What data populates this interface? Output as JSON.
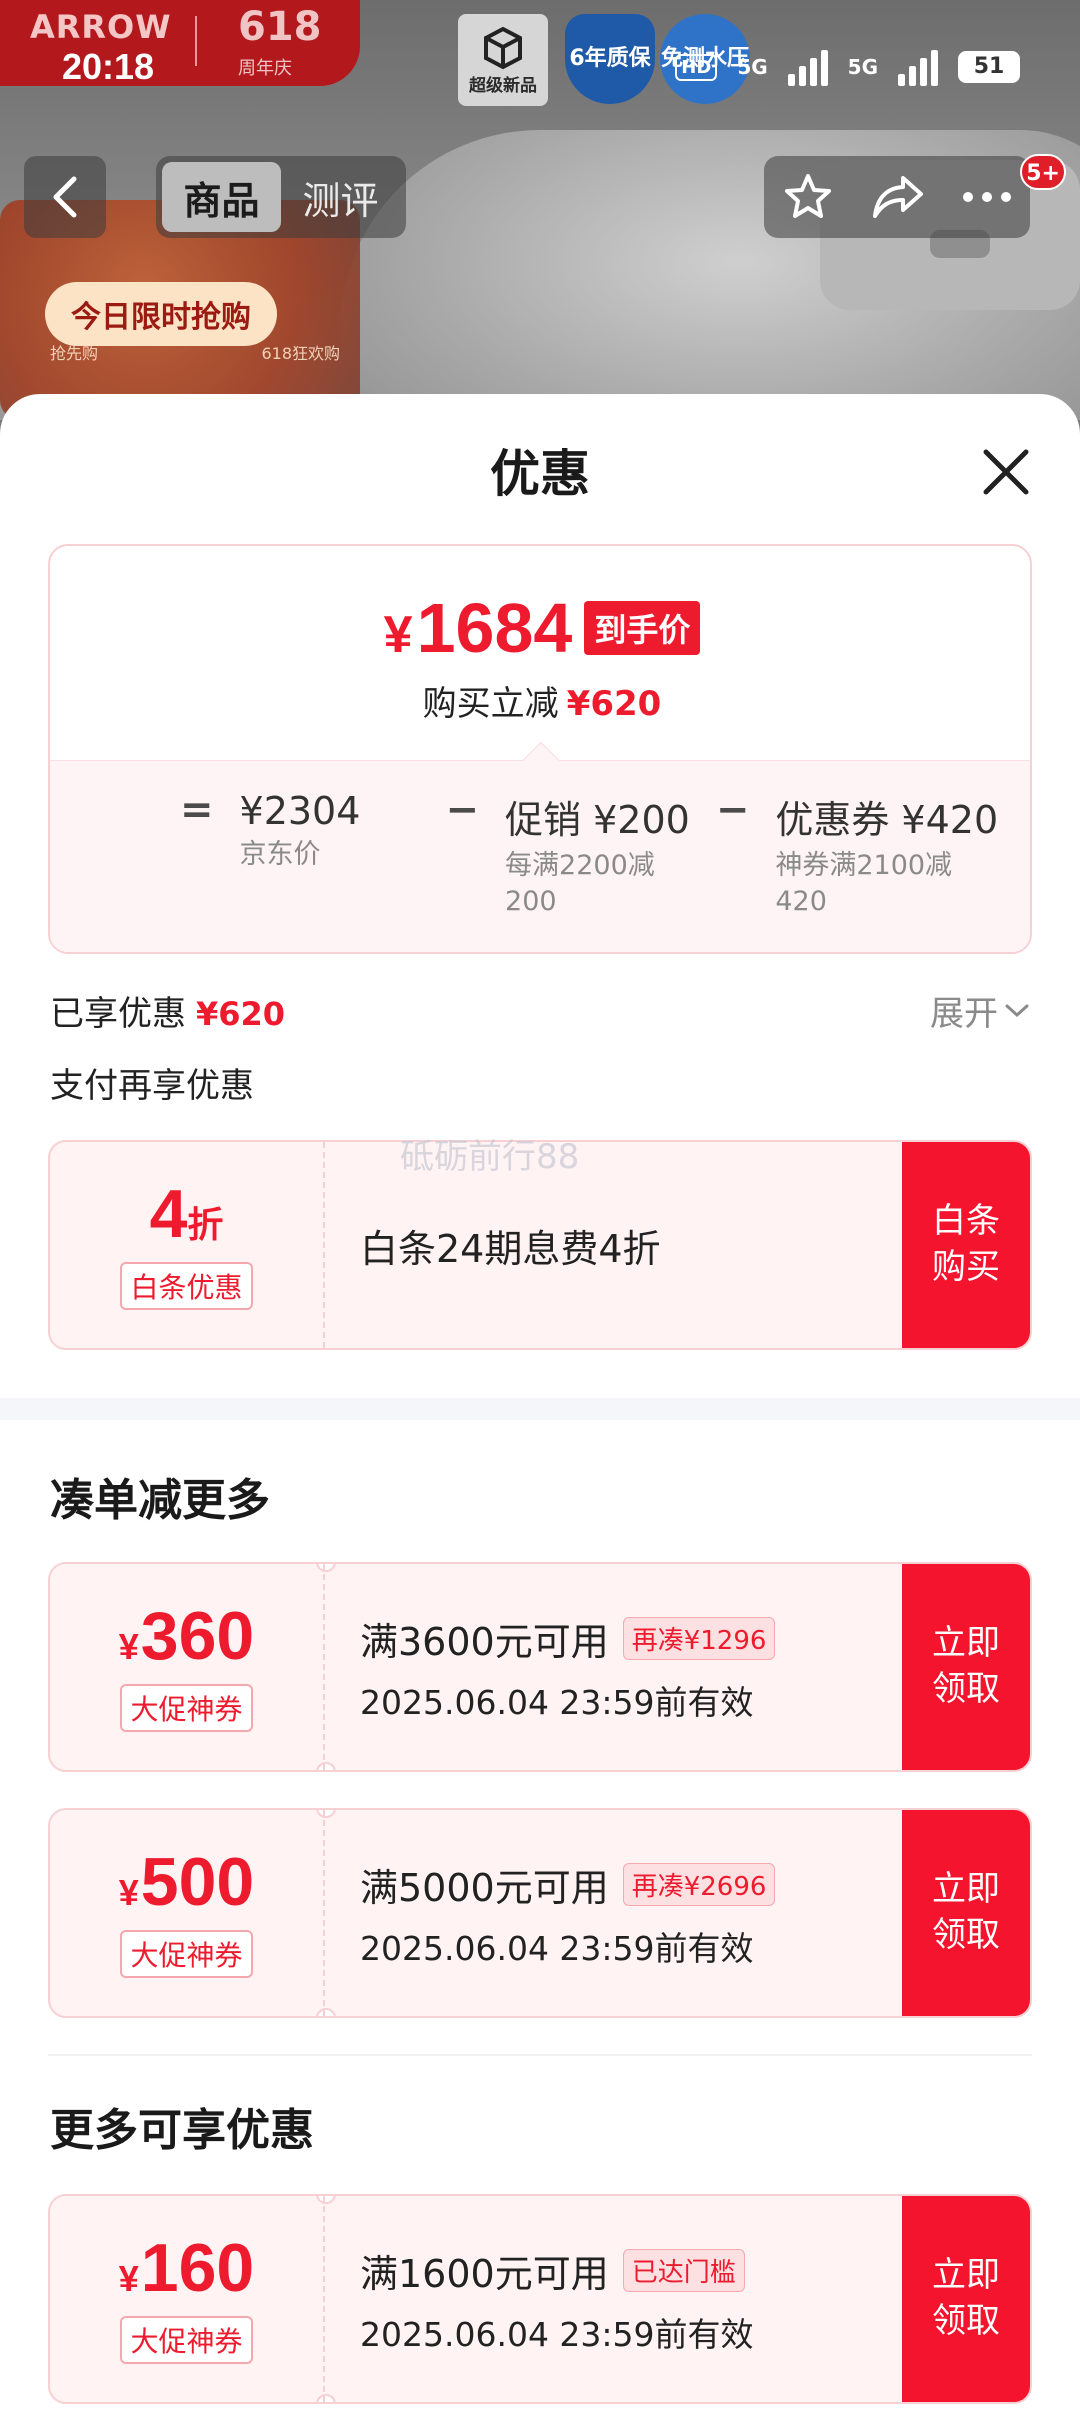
{
  "status_bar": {
    "time": "20:18",
    "hd": "HD",
    "net1": "5G",
    "net2": "5G",
    "battery": "51"
  },
  "background": {
    "brand": "ARROW",
    "anniversary_num": "618",
    "anniversary_text": "周年庆",
    "badge_1": "超级新品",
    "badge_2": "6年质保",
    "badge_3": "免测水压",
    "promo_label": "今日限时抢购",
    "promo_left": "抢先购",
    "promo_right": "618狂欢购"
  },
  "nav": {
    "tabs": [
      "商品",
      "测评"
    ],
    "cart_count": "5+"
  },
  "sheet": {
    "title": "优惠",
    "final_price_symbol": "¥",
    "final_price": "1684",
    "final_price_tag": "到手价",
    "save_label": "购买立减",
    "save_amount": "¥620",
    "calc": {
      "eq": "=",
      "minus": "−",
      "terms": [
        {
          "title": "¥2304",
          "sub": "京东价"
        },
        {
          "title": "促销 ¥200",
          "sub": "每满2200减200"
        },
        {
          "title": "优惠券 ¥420",
          "sub": "神券满2100减420"
        }
      ]
    },
    "enjoyed_label": "已享优惠",
    "enjoyed_amount": "¥620",
    "expand_label": "展开",
    "pay_more_label": "支付再享优惠",
    "watermark": "砥砺前行88",
    "baitiao": {
      "amount": "4",
      "unit": "折",
      "kind": "白条优惠",
      "desc": "白条24期息费4折",
      "action": "白条购买"
    },
    "section_more": "凑单减更多",
    "section_enjoy": "更多可享优惠",
    "coupons": [
      {
        "symbol": "¥",
        "amount": "360",
        "kind": "大促神券",
        "cond": "满3600元可用",
        "tag": "再凑¥1296",
        "valid": "2025.06.04 23:59前有效",
        "action": "立即领取"
      },
      {
        "symbol": "¥",
        "amount": "500",
        "kind": "大促神券",
        "cond": "满5000元可用",
        "tag": "再凑¥2696",
        "valid": "2025.06.04 23:59前有效",
        "action": "立即领取"
      },
      {
        "symbol": "¥",
        "amount": "160",
        "kind": "大促神券",
        "cond": "满1600元可用",
        "tag": "已达门槛",
        "valid": "2025.06.04 23:59前有效",
        "action": "立即领取"
      }
    ]
  },
  "colors": {
    "accent": "#ee1b2e",
    "action_bg": "#f5142e",
    "card_bg": "#fff3f4"
  },
  "icons": [
    "back-icon",
    "star-icon",
    "share-icon",
    "more-icon",
    "close-icon",
    "chevron-down-icon"
  ]
}
